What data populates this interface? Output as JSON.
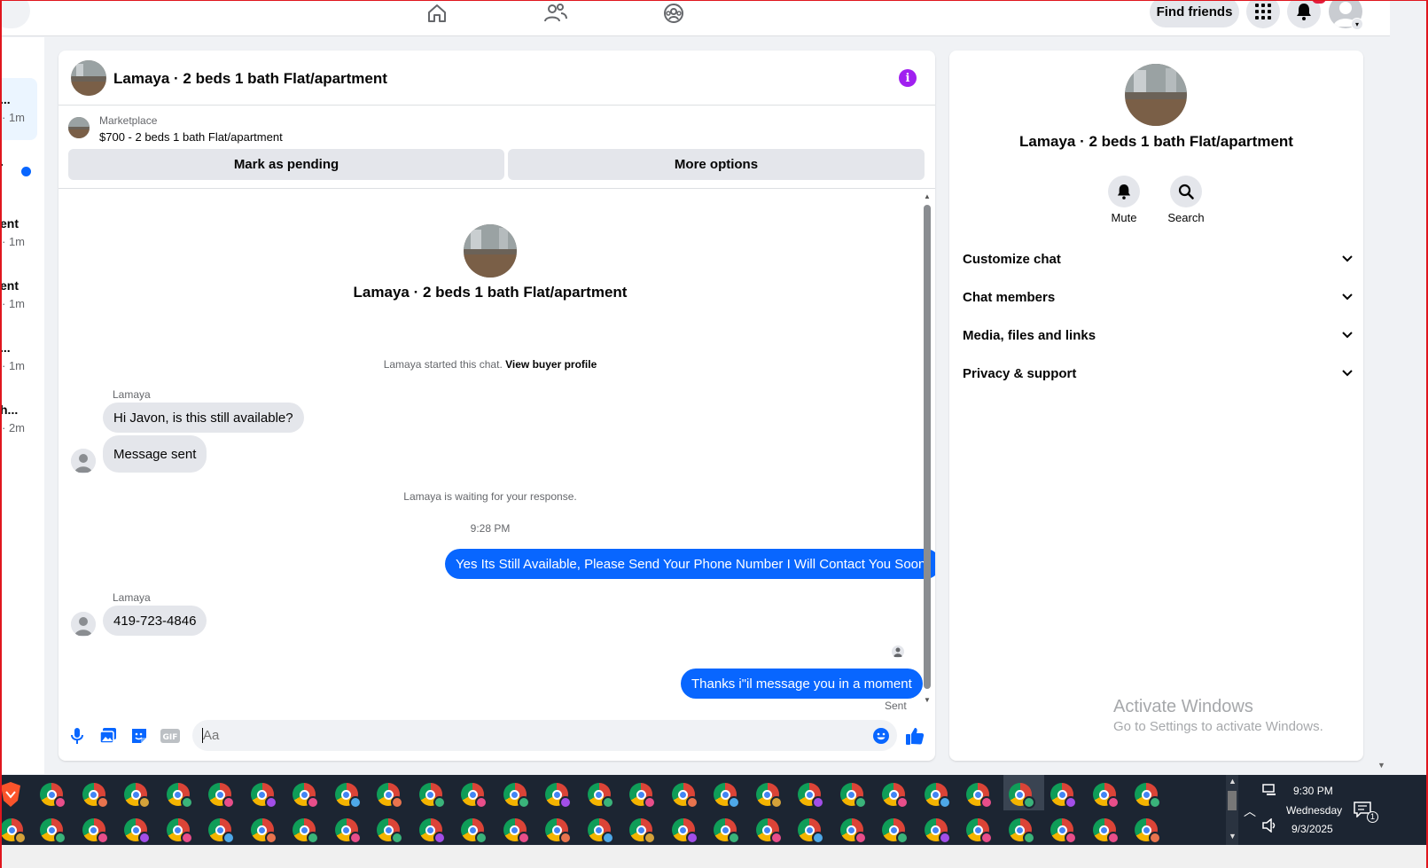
{
  "topbar": {
    "find_friends": "Find friends",
    "icons": [
      "home-icon",
      "friends-icon",
      "groups-icon",
      "menu-grid-icon",
      "bell-icon",
      "account-avatar"
    ]
  },
  "sidebar": {
    "items": [
      {
        "name": "...",
        "time": "1m",
        "active": true,
        "unread": false
      },
      {
        "name": ".",
        "time": "",
        "active": false,
        "unread": true
      },
      {
        "name": "ent",
        "time": "1m",
        "active": false,
        "unread": false
      },
      {
        "name": "ent",
        "time": "1m",
        "active": false,
        "unread": false
      },
      {
        "name": "...",
        "time": "1m",
        "active": false,
        "unread": false
      },
      {
        "name": "h...",
        "time": "2m",
        "active": false,
        "unread": false
      }
    ]
  },
  "chat": {
    "title": "Lamaya · 2 beds 1 bath Flat/apartment",
    "marketplace_label": "Marketplace",
    "listing": "$700 - 2 beds 1 bath Flat/apartment",
    "mark_pending": "Mark as pending",
    "more_options": "More options",
    "center_title": "Lamaya · 2 beds 1 bath Flat/apartment",
    "started_text": "Lamaya started this chat.",
    "view_buyer": "View buyer profile",
    "sender1": "Lamaya",
    "msg_in_1": "Hi Javon, is this still available?",
    "msg_in_2": "Message sent",
    "waiting": "Lamaya is waiting for your response.",
    "time_stamp": "9:28 PM",
    "msg_out_1": "Yes Its Still Available, Please Send Your Phone Number I Will Contact You Soon.",
    "sender2": "Lamaya",
    "msg_in_3": "419-723-4846",
    "msg_out_2": "Thanks i\"il message you in a moment",
    "sent_label": "Sent",
    "composer_placeholder": "Aa"
  },
  "info_panel": {
    "title": "Lamaya · 2 beds 1 bath Flat/apartment",
    "mute": "Mute",
    "search": "Search",
    "sections": [
      "Customize chat",
      "Chat members",
      "Media, files and links",
      "Privacy & support"
    ]
  },
  "watermark": {
    "line1": "Activate Windows",
    "line2": "Go to Settings to activate Windows."
  },
  "taskbar": {
    "time": "9:30 PM",
    "day": "Wednesday",
    "date": "9/3/2025",
    "notification_count": "1"
  },
  "colors": {
    "accent": "#0866ff",
    "info": "#a020f0",
    "badge": "#e41e3f"
  }
}
